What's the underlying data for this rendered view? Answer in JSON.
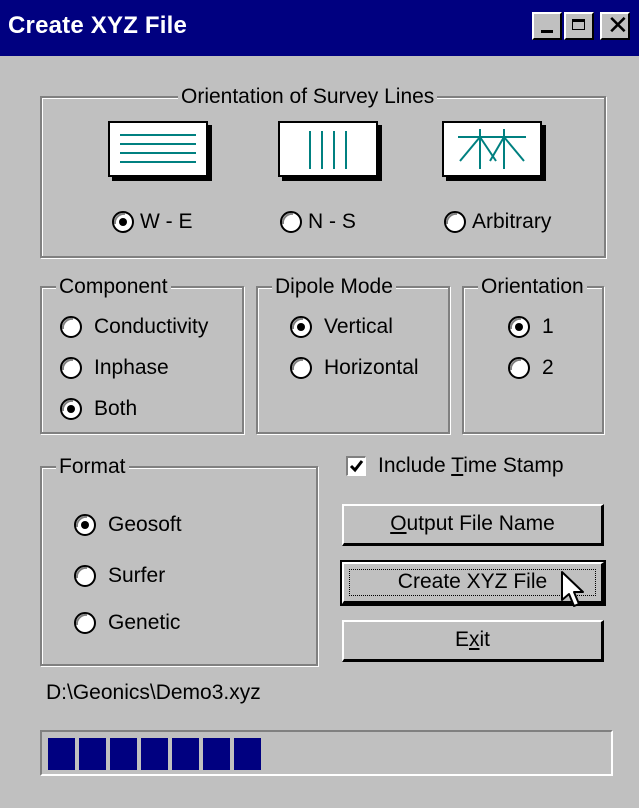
{
  "window": {
    "title": "Create XYZ File",
    "close_glyph": "✕"
  },
  "survey": {
    "legend": "Orientation of Survey Lines",
    "options": [
      {
        "label": "W - E",
        "selected": true,
        "icon": "horizontal-lines-icon"
      },
      {
        "label": "N - S",
        "selected": false,
        "icon": "vertical-lines-icon"
      },
      {
        "label": "Arbitrary",
        "selected": false,
        "icon": "arbitrary-lines-icon"
      }
    ]
  },
  "component": {
    "legend": "Component",
    "options": [
      {
        "label": "Conductivity",
        "selected": false
      },
      {
        "label": "Inphase",
        "selected": false
      },
      {
        "label": "Both",
        "selected": true
      }
    ]
  },
  "dipole": {
    "legend": "Dipole Mode",
    "options": [
      {
        "label": "Vertical",
        "selected": true
      },
      {
        "label": "Horizontal",
        "selected": false
      }
    ]
  },
  "orientation": {
    "legend": "Orientation",
    "options": [
      {
        "label": "1",
        "selected": true
      },
      {
        "label": "2",
        "selected": false
      }
    ]
  },
  "format": {
    "legend": "Format",
    "options": [
      {
        "label": "Geosoft",
        "selected": true
      },
      {
        "label": "Surfer",
        "selected": false
      },
      {
        "label": "Genetic",
        "selected": false
      }
    ]
  },
  "timestamp": {
    "pre": "Include ",
    "accel": "T",
    "post": "ime Stamp",
    "checked": true
  },
  "buttons": {
    "output": {
      "accel": "O",
      "post": "utput File Name"
    },
    "create": {
      "label": "Create XYZ File"
    },
    "exit": {
      "pre": "E",
      "accel": "x",
      "post": "it"
    }
  },
  "file_path": "D:\\Geonics\\Demo3.xyz",
  "progress": {
    "filled_blocks": 7,
    "fraction": 0.39
  },
  "colors": {
    "title_bar": "#000080",
    "face": "#c0c0c0",
    "icon_lines": "#008080",
    "progress": "#000080"
  }
}
